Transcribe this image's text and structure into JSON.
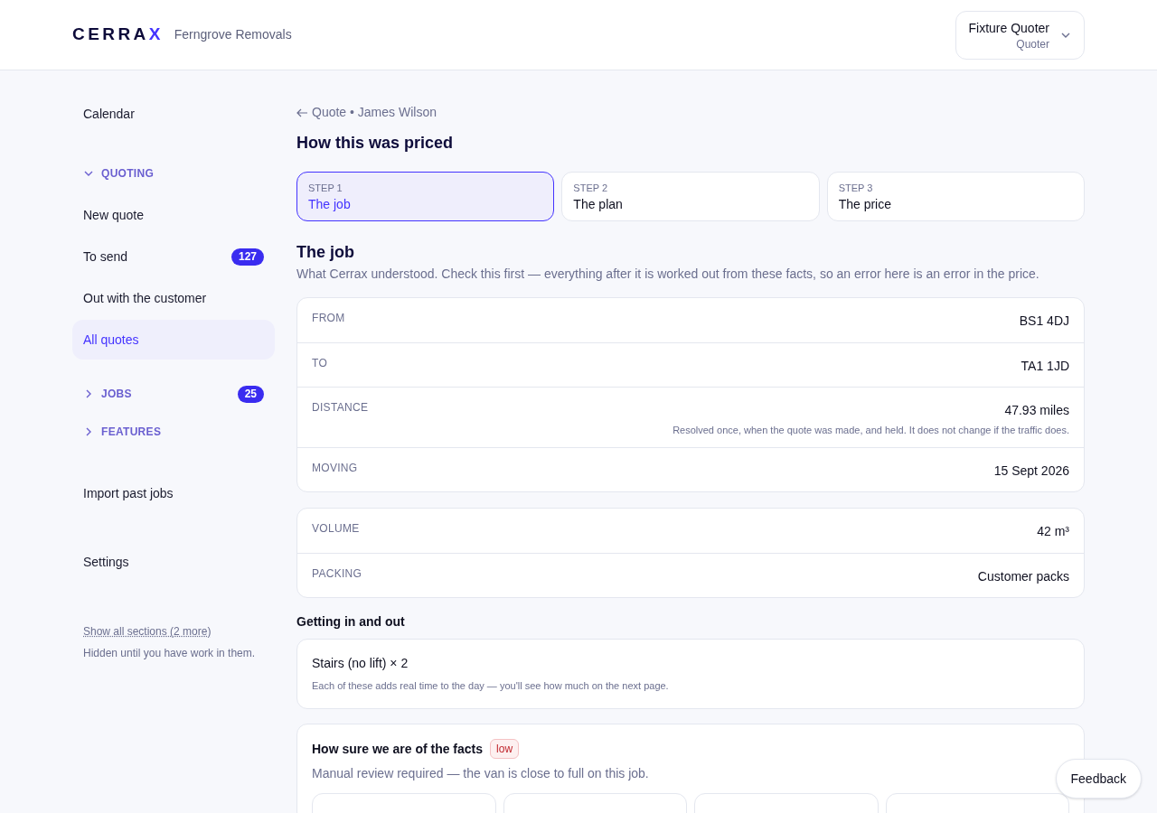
{
  "header": {
    "logo": {
      "text": "CERRA",
      "accent": "X"
    },
    "company": "Ferngrove Removals",
    "account": {
      "name": "Fixture Quoter",
      "role": "Quoter"
    }
  },
  "sidebar": {
    "items": [
      {
        "kind": "link",
        "label": "Calendar",
        "selected": false
      },
      {
        "kind": "section",
        "label": "QUOTING",
        "expanded": true
      },
      {
        "kind": "link",
        "label": "New quote",
        "selected": false
      },
      {
        "kind": "link",
        "label": "To send",
        "selected": false,
        "badge": "127"
      },
      {
        "kind": "link",
        "label": "Out with the customer",
        "selected": false
      },
      {
        "kind": "link",
        "label": "All quotes",
        "selected": true
      },
      {
        "kind": "section",
        "label": "JOBS",
        "expanded": false,
        "badge": "25"
      },
      {
        "kind": "section",
        "label": "FEATURES",
        "expanded": false
      },
      {
        "kind": "link",
        "label": "Import past jobs",
        "selected": false
      },
      {
        "kind": "link",
        "label": "Settings",
        "selected": false
      }
    ],
    "footer": {
      "link": "Show all sections (2 more)",
      "note": "Hidden until you have work in them."
    }
  },
  "breadcrumb": "Quote • James Wilson",
  "title": "How this was priced",
  "steps": [
    {
      "label": "STEP 1",
      "title": "The job",
      "selected": true
    },
    {
      "label": "STEP 2",
      "title": "The plan",
      "selected": false
    },
    {
      "label": "STEP 3",
      "title": "The price",
      "selected": false
    }
  ],
  "section": {
    "title": "The job",
    "intro": "What Cerrax understood. Check this first — everything after it is worked out from these facts, so an error here is an error in the price."
  },
  "fact_cards": [
    {
      "rows": [
        {
          "label": "FROM",
          "value": "BS1 4DJ"
        },
        {
          "label": "TO",
          "value": "TA1 1JD"
        },
        {
          "label": "DISTANCE",
          "value": "47.93 miles",
          "note": "Resolved once, when the quote was made, and held. It does not change if the traffic does."
        },
        {
          "label": "MOVING",
          "value": "15 Sept 2026"
        }
      ]
    },
    {
      "rows": [
        {
          "label": "VOLUME",
          "value": "42 m³"
        },
        {
          "label": "PACKING",
          "value": "Customer packs"
        }
      ]
    }
  ],
  "access": {
    "title": "Getting in and out",
    "item": "Stairs (no lift) × 2",
    "note": "Each of these adds real time to the day — you'll see how much on the next page."
  },
  "confidence": {
    "title": "How sure we are of the facts",
    "badge": "low",
    "note": "Manual review required — the van is close to full on this job."
  },
  "feedback": "Feedback"
}
